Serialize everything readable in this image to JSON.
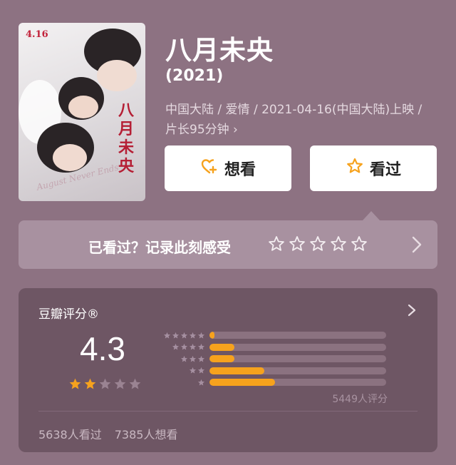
{
  "poster": {
    "date_text": "4.16",
    "title_text": "八月未央",
    "subtitle_text": "August Never Ends"
  },
  "movie": {
    "title": "八月未央",
    "year": "(2021)",
    "meta": "中国大陆 / 爱情 / 2021-04-16(中国大陆)上映 / 片长95分钟 ›"
  },
  "buttons": {
    "want_label": "想看",
    "seen_label": "看过"
  },
  "rate_prompt": {
    "text": "已看过？记录此刻感受",
    "star_count": 5
  },
  "rating": {
    "label": "豆瓣评分®",
    "score": "4.3",
    "stars_filled": 2,
    "stars_total": 5,
    "distribution": [
      {
        "stars": 5,
        "fraction": 0.03
      },
      {
        "stars": 4,
        "fraction": 0.14
      },
      {
        "stars": 3,
        "fraction": 0.14
      },
      {
        "stars": 2,
        "fraction": 0.31
      },
      {
        "stars": 1,
        "fraction": 0.37
      }
    ],
    "count_text": "5449人评分",
    "seen_text": "5638人看过",
    "want_text": "7385人想看"
  },
  "colors": {
    "background": "#8d7282",
    "card": "#6e5664",
    "accent": "#f6a21d"
  }
}
